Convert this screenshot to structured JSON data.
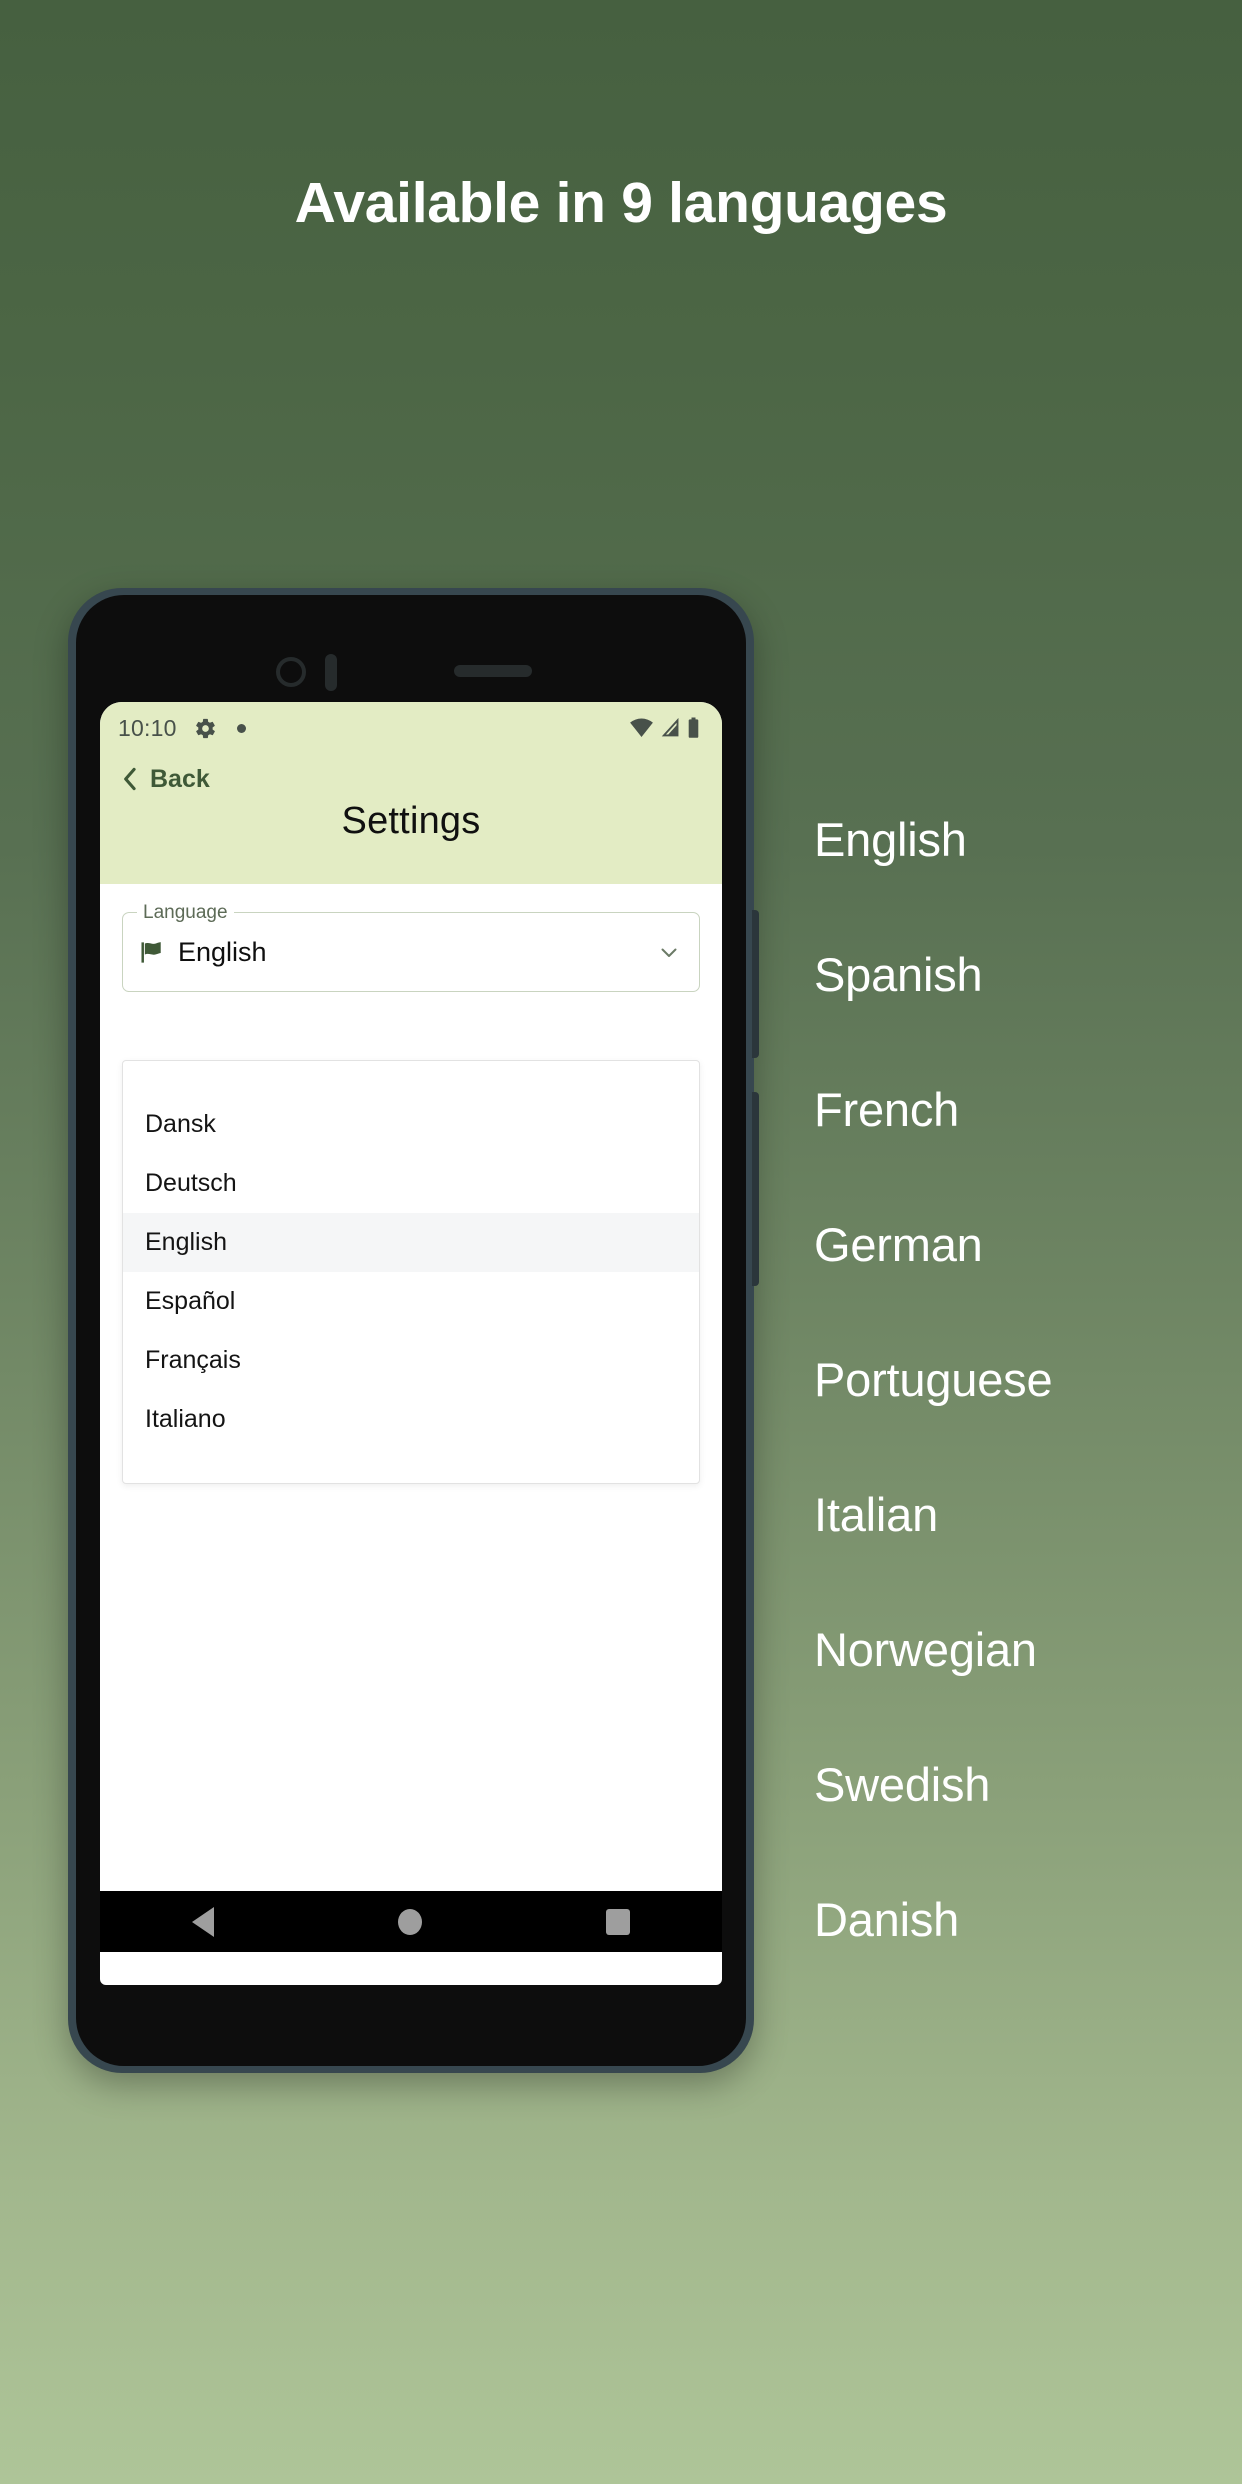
{
  "headline": "Available in 9 languages",
  "colors": {
    "bg_top": "#466040",
    "bg_bottom": "#aec598",
    "appbar": "#e3ecc4",
    "accent_green": "#3f5937",
    "phone_frame": "#37474f",
    "selected_row": "#f5f6f7"
  },
  "phone": {
    "status_bar": {
      "time": "10:10",
      "gear_icon": "gear-icon",
      "dot_icon": "dot-indicator-icon",
      "wifi_icon": "wifi-icon",
      "signal_icon": "cellular-signal-icon",
      "battery_icon": "battery-icon"
    },
    "app_bar": {
      "back_label": "Back",
      "back_icon": "chevron-left-icon",
      "title": "Settings"
    },
    "language_field": {
      "label": "Language",
      "value": "English",
      "flag_icon": "flag-icon",
      "chevron_icon": "chevron-down-icon"
    },
    "dropdown": {
      "options": [
        {
          "label": "Dansk",
          "selected": false
        },
        {
          "label": "Deutsch",
          "selected": false
        },
        {
          "label": "English",
          "selected": true
        },
        {
          "label": "Español",
          "selected": false
        },
        {
          "label": "Français",
          "selected": false
        },
        {
          "label": "Italiano",
          "selected": false
        }
      ]
    },
    "nav_bar": {
      "back_icon": "android-back-icon",
      "home_icon": "android-home-icon",
      "recents_icon": "android-recents-icon"
    }
  },
  "languages": [
    "English",
    "Spanish",
    "French",
    "German",
    "Portuguese",
    "Italian",
    "Norwegian",
    "Swedish",
    "Danish"
  ]
}
